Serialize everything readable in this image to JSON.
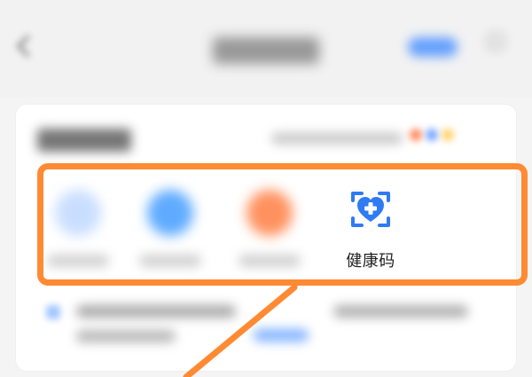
{
  "services": [
    {
      "icon": "blurred-circle-icon",
      "label": "",
      "color": "#bcd6ff"
    },
    {
      "icon": "blurred-circle-icon",
      "label": "",
      "color": "#58a7ff"
    },
    {
      "icon": "blurred-circle-icon",
      "label": "",
      "color": "#ff8c57"
    },
    {
      "icon": "health-code-icon",
      "label": "健康码",
      "color": "#2f7bf4"
    }
  ],
  "highlight": {
    "color": "#ff8a34"
  },
  "arrow": {
    "color": "#ff8a34"
  }
}
